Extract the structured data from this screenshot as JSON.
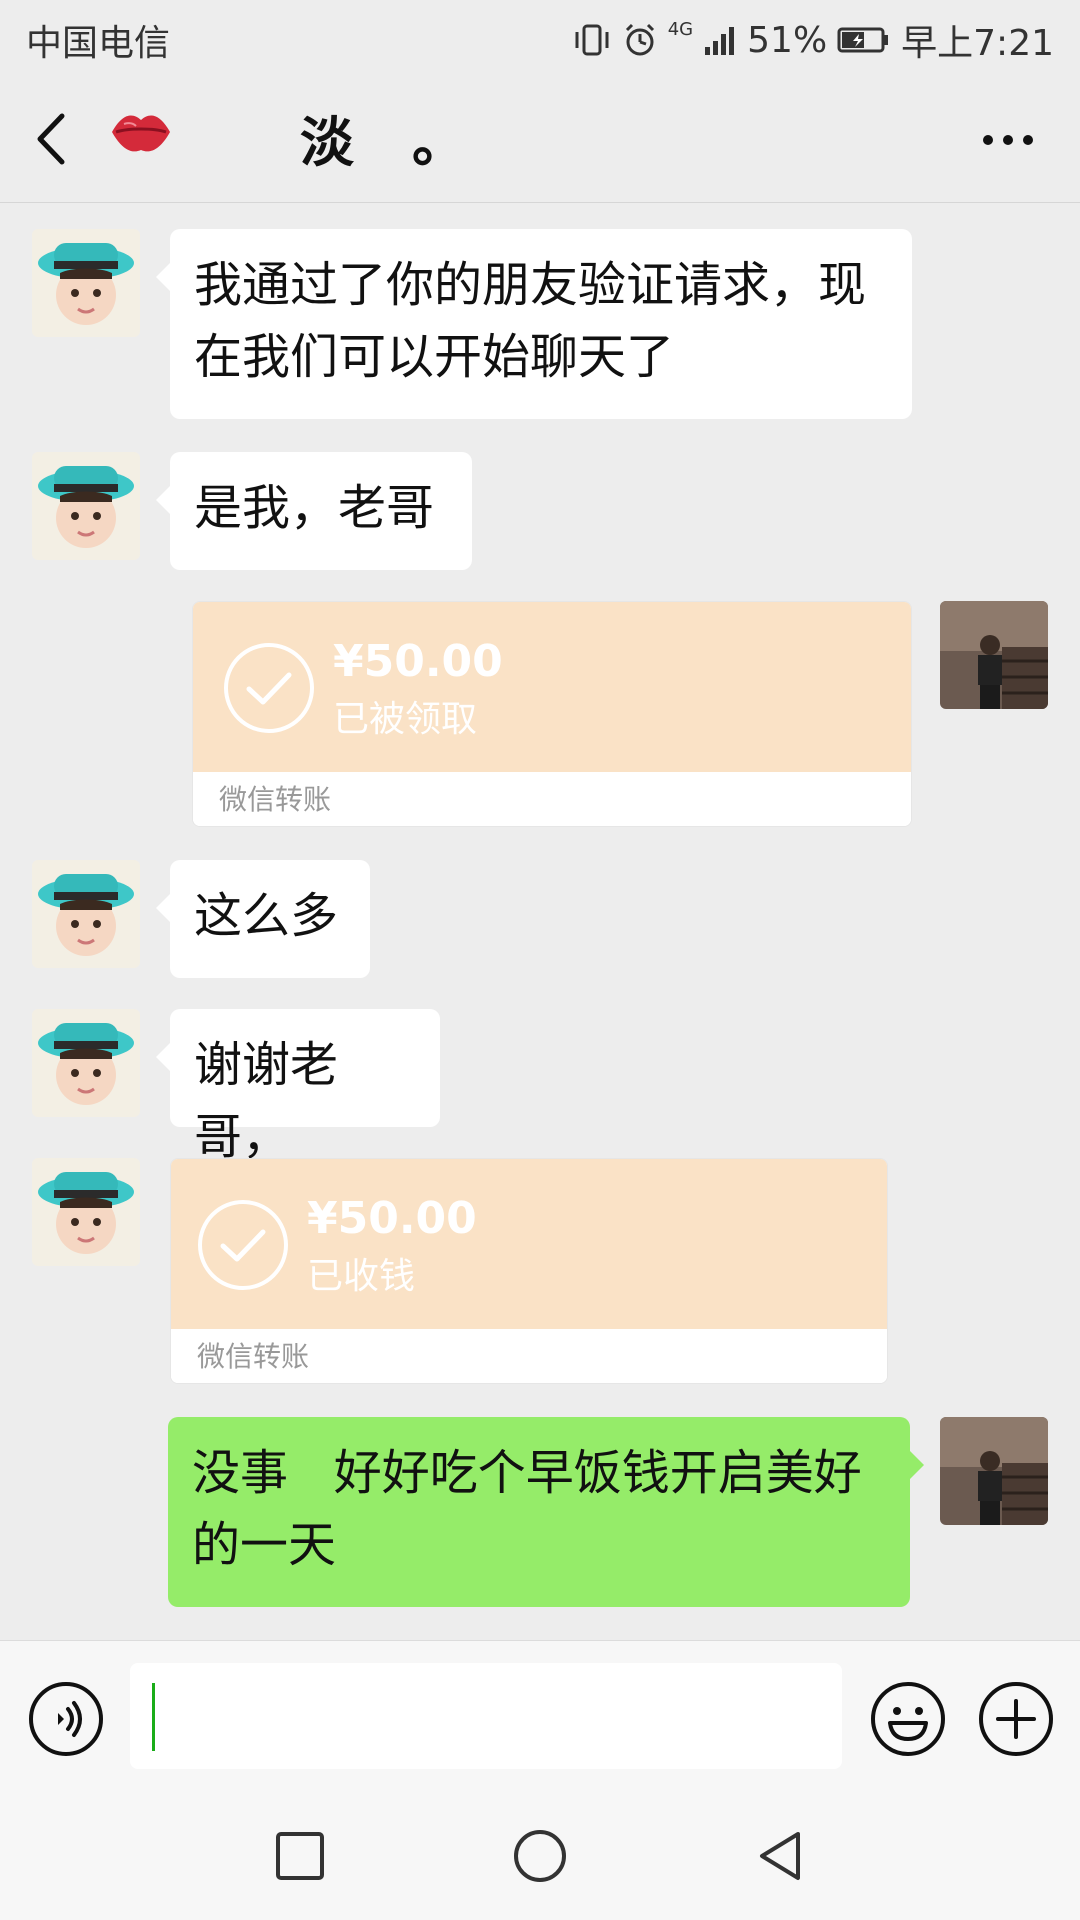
{
  "status_bar": {
    "carrier": "中国电信",
    "network": "4G",
    "battery": "51%",
    "time": "早上7:21",
    "icons": [
      "vibrate-icon",
      "alarm-icon",
      "signal-icon",
      "battery-icon"
    ]
  },
  "header": {
    "title": "淡　。",
    "back_icon": "chevron-left-icon",
    "contact_icon": "lips-icon",
    "more_icon": "more-dots-icon"
  },
  "messages": [
    {
      "side": "left",
      "type": "text",
      "text_lines": [
        "我通过了你的朋友验证请求，现",
        "在我们可以开始聊天了"
      ]
    },
    {
      "side": "left",
      "type": "text",
      "text_lines": [
        "是我，老哥"
      ]
    },
    {
      "side": "right",
      "type": "transfer",
      "amount": "¥50.00",
      "status": "已被领取",
      "footer": "微信转账"
    },
    {
      "side": "left",
      "type": "text",
      "text_lines": [
        "这么多"
      ]
    },
    {
      "side": "left",
      "type": "text",
      "text_lines": [
        "谢谢老哥，"
      ]
    },
    {
      "side": "left",
      "type": "transfer",
      "amount": "¥50.00",
      "status": "已收钱",
      "footer": "微信转账"
    },
    {
      "side": "right",
      "type": "text",
      "text_lines": [
        "没事   好好吃个早饭钱开启美好",
        "的一天"
      ]
    }
  ],
  "input_bar": {
    "value": "",
    "voice_icon": "voice-icon",
    "emoji_icon": "emoji-icon",
    "plus_icon": "plus-icon"
  },
  "system_nav": {
    "icons": [
      "recent-apps-icon",
      "home-icon",
      "back-triangle-icon"
    ]
  },
  "colors": {
    "background": "#ededed",
    "sent_bubble": "#95ec69",
    "transfer_card": "#fae2c6"
  }
}
